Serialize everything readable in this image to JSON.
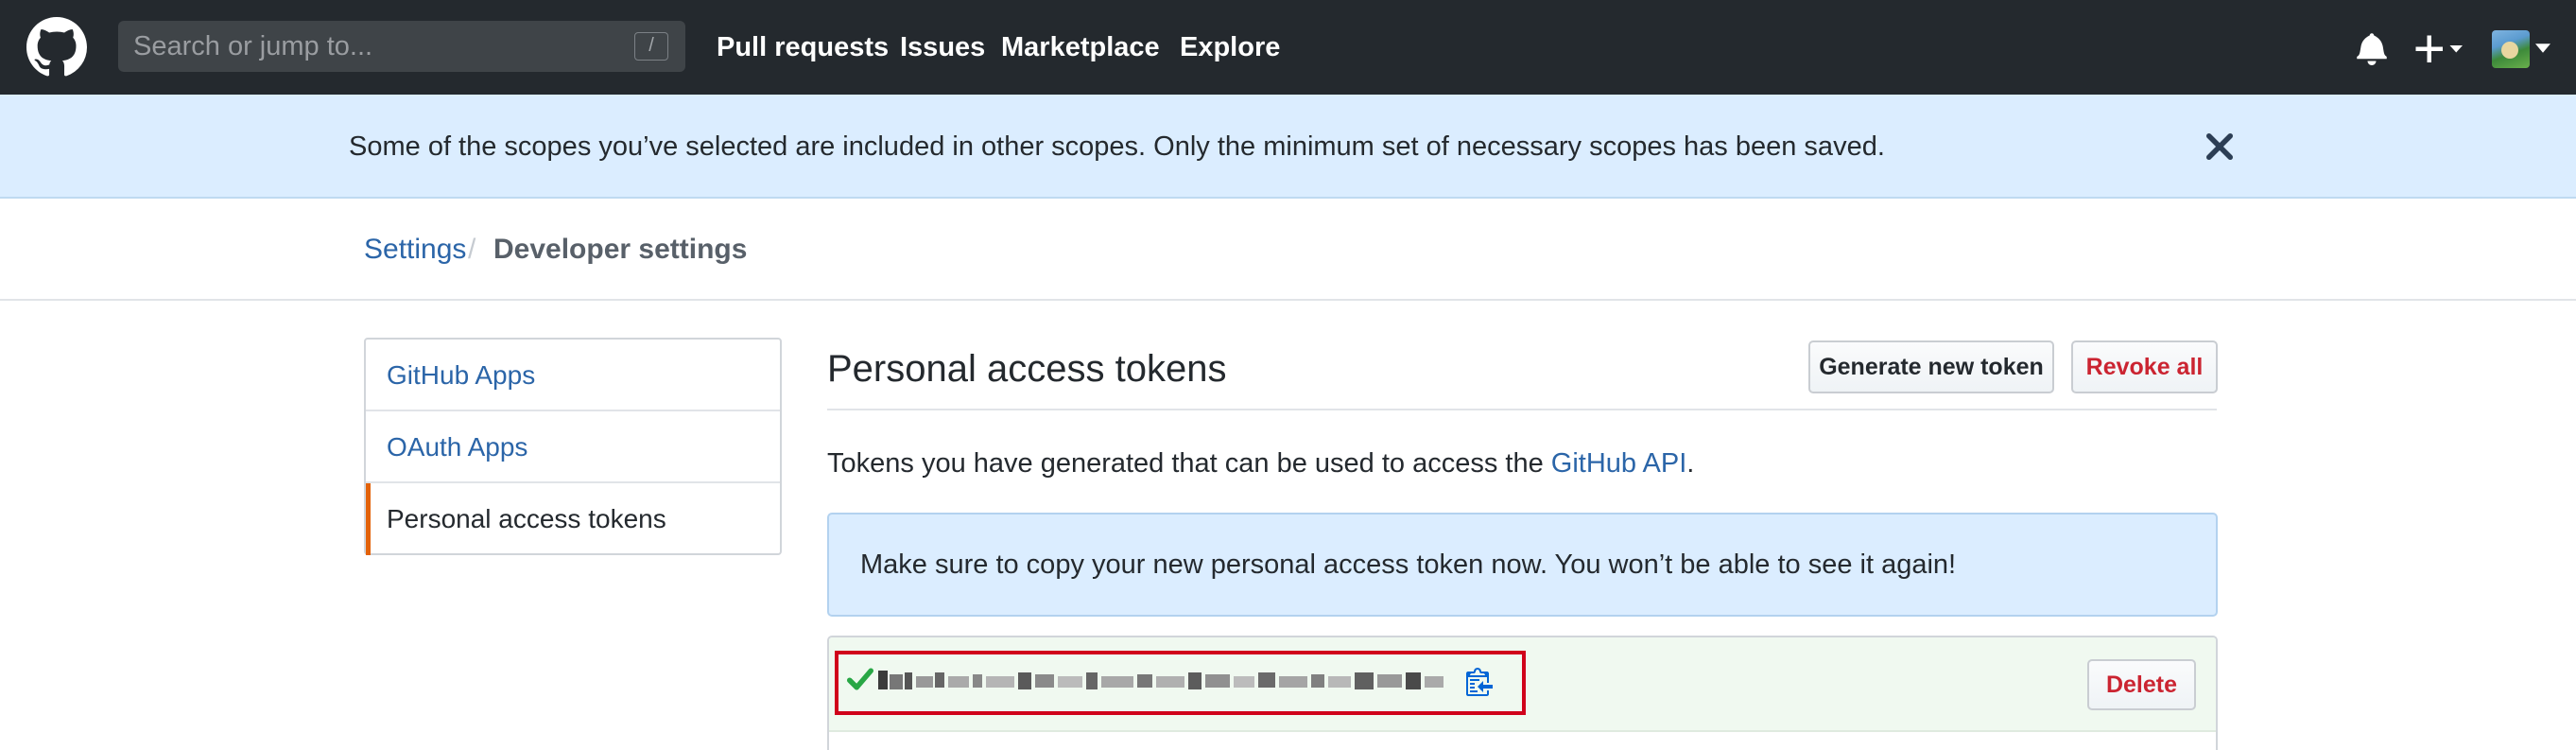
{
  "header": {
    "search_placeholder": "Search or jump to...",
    "search_shortcut": "/",
    "nav": [
      "Pull requests",
      "Issues",
      "Marketplace",
      "Explore"
    ],
    "icons": [
      "github-logo-icon",
      "bell-icon",
      "plus-icon",
      "avatar"
    ]
  },
  "flash": {
    "message": "Some of the scopes you’ve selected are included in other scopes. Only the minimum set of necessary scopes has been saved."
  },
  "breadcrumb": {
    "settings": "Settings",
    "separator": "/",
    "current": "Developer settings"
  },
  "sidebar": {
    "items": [
      {
        "label": "GitHub Apps"
      },
      {
        "label": "OAuth Apps"
      },
      {
        "label": "Personal access tokens"
      }
    ],
    "selected_index": 2
  },
  "main": {
    "title": "Personal access tokens",
    "generate_button": "Generate new token",
    "revoke_button": "Revoke all",
    "description_prefix": "Tokens you have generated that can be used to access the ",
    "description_link": "GitHub API",
    "description_suffix": ".",
    "notice": "Make sure to copy your new personal access token now. You won’t be able to see it again!",
    "delete_button": "Delete"
  },
  "colors": {
    "header_bg": "#24292e",
    "flash_bg": "#dbedff",
    "link": "#2b65a8",
    "danger": "#cb2431",
    "selected_accent": "#e36209",
    "success": "#28a745",
    "highlight": "#d0021b"
  }
}
